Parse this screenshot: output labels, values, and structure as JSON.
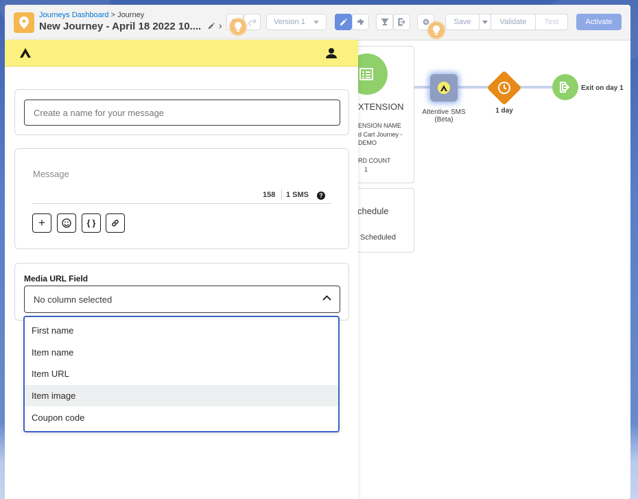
{
  "header": {
    "breadcrumb_link": "Journeys Dashboard",
    "breadcrumb_sep": " > ",
    "breadcrumb_current": "Journey",
    "title": "New Journey - April 18 2022 10....",
    "version_label": "Version 1",
    "save_label": "Save",
    "validate_label": "Validate",
    "test_label": "Test",
    "activate_label": "Activate"
  },
  "canvas": {
    "entry_card": {
      "title": "XTENSION",
      "name_label": "ENSION NAME",
      "name_value_1": "d Cart Journey -",
      "name_value_2": "DEMO",
      "count_label": "RD COUNT",
      "count_value": "1"
    },
    "schedule_card": {
      "title": "chedule",
      "status": "Scheduled"
    },
    "nodes": {
      "sms_label": "Attentive SMS",
      "sms_sublabel": "(Beta)",
      "wait_label": "1 day",
      "exit_label": "Exit on day 1"
    }
  },
  "panel": {
    "name_input": {
      "placeholder": "Create a name for your message"
    },
    "message": {
      "placeholder": "Message",
      "char_count": "158",
      "sms_count": "1 SMS",
      "help": "?"
    },
    "toolbar": {
      "add": "+",
      "variable": "{ }"
    },
    "media": {
      "label": "Media URL Field",
      "selected": "No column selected",
      "options": [
        "First name",
        "Item name",
        "Item URL",
        "Item image",
        "Coupon code"
      ]
    }
  }
}
